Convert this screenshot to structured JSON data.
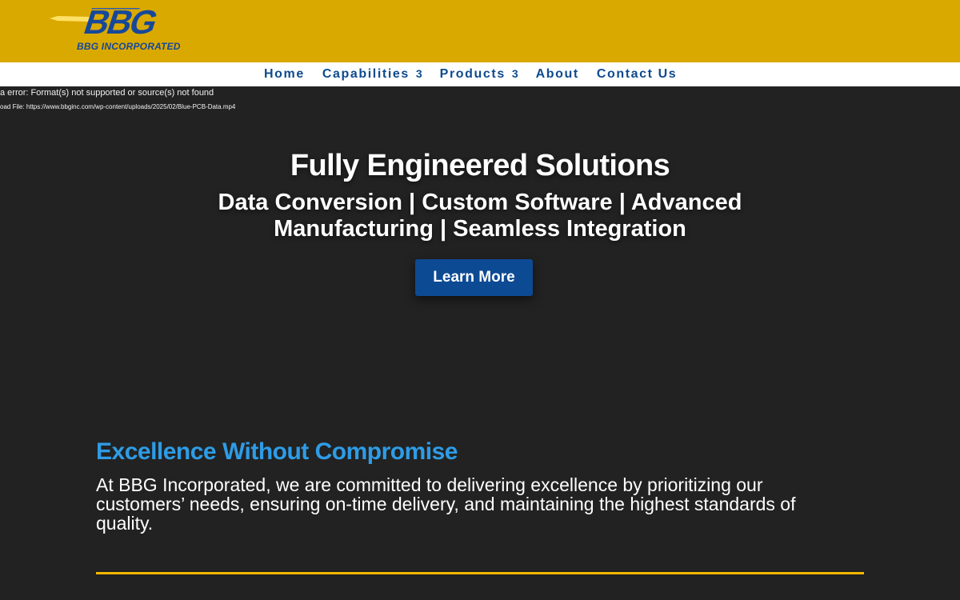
{
  "header": {
    "logo_text": "BBG",
    "logo_caption": "BBG INCORPORATED",
    "colors": {
      "bar": "#daa900",
      "logo_blue": "#16489a"
    }
  },
  "nav": {
    "items": [
      {
        "label": "Home",
        "has_submenu": false
      },
      {
        "label": "Capabilities",
        "has_submenu": true,
        "caret": "3"
      },
      {
        "label": "Products",
        "has_submenu": true,
        "caret": "3"
      },
      {
        "label": "About",
        "has_submenu": false
      },
      {
        "label": "Contact Us",
        "has_submenu": false
      }
    ]
  },
  "media": {
    "error": "a error: Format(s) not supported or source(s) not found",
    "file": "oad File: https://www.bbginc.com/wp-content/uploads/2025/02/Blue-PCB-Data.mp4"
  },
  "hero": {
    "title": "Fully Engineered Solutions",
    "subtitle": "Data Conversion | Custom Software | Advanced Manufacturing | Seamless Integration",
    "button_label": "Learn More"
  },
  "intro": {
    "title": "Excellence Without Compromise",
    "body": "At BBG Incorporated, we are committed to delivering excellence by prioritizing our customers’ needs, ensuring on-time delivery, and maintaining the highest standards of quality."
  },
  "colors": {
    "page_bg": "#222222",
    "nav_text": "#0e4a8e",
    "button_bg": "#0d4a94",
    "section_title": "#2e9ce6",
    "divider": "#f4b800"
  }
}
